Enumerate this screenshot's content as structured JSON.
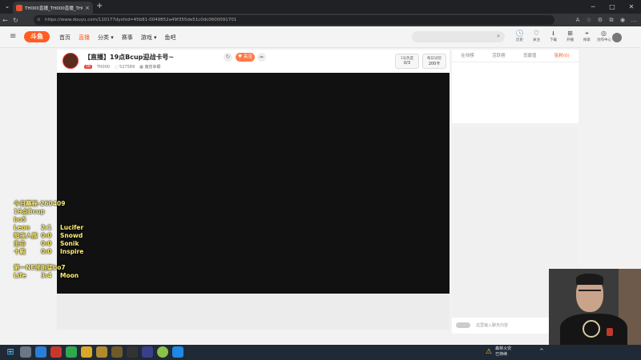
{
  "browser": {
    "tab_title": "TH000直播_TH000直播_TH000视频",
    "tab_close": "×",
    "new_tab": "+",
    "url": "https://www.douyu.com/110177dyshid=45b81-0049852a49f355de51c0dc0600091701",
    "window_controls": [
      "─",
      "□",
      "✕"
    ]
  },
  "site": {
    "logo_text": "斗鱼",
    "nav": [
      {
        "label": "首页",
        "active": false
      },
      {
        "label": "直播",
        "active": true
      },
      {
        "label": "分类 ▾",
        "active": false
      },
      {
        "label": "赛事",
        "active": false
      },
      {
        "label": "游戏 ▾",
        "active": false
      },
      {
        "label": "鱼吧",
        "active": false
      }
    ],
    "header_icons": [
      {
        "icon": "history-icon",
        "glyph": "🕒",
        "label": "历史"
      },
      {
        "icon": "heart-icon",
        "glyph": "♡",
        "label": "关注"
      },
      {
        "icon": "download-icon",
        "glyph": "⭳",
        "label": "下载"
      },
      {
        "icon": "broadcast-icon",
        "glyph": "⊞",
        "label": "开播"
      },
      {
        "icon": "map-pin-icon",
        "glyph": "⌖",
        "label": "探索"
      },
      {
        "icon": "creator-icon",
        "glyph": "◎",
        "label": "创作中心"
      }
    ]
  },
  "room": {
    "title": "【直播】19点Bcup迎战卡号~",
    "follow_label": "关注",
    "level_badge": "18",
    "streamer": "TH000",
    "hot_count": "527589",
    "category": "魔兽争霸",
    "hot_label": "1号热度",
    "hot_value": "0/3",
    "daily_label": "每日试玩",
    "daily_value": "200卡"
  },
  "overlay": {
    "line1": "今日赛程-260409",
    "line2": "19点Bcup",
    "line3": "bo5",
    "matches": [
      {
        "a": "Leon",
        "score": "2:1",
        "b": "Lucifer"
      },
      {
        "a": "暗夜人族",
        "score": "0:0",
        "b": "Snowd"
      },
      {
        "a": "生命",
        "score": "0:0",
        "b": "Sonik"
      },
      {
        "a": "十殿",
        "score": "0:0",
        "b": "Inspire"
      }
    ],
    "line_final": "第一NE领跑猛bo7",
    "final_match": {
      "a": "Life",
      "score": "3:4",
      "b": "Moon"
    }
  },
  "right_panel": {
    "tabs": [
      {
        "label": "在线榜",
        "active": false
      },
      {
        "label": "活跃榜",
        "active": false
      },
      {
        "label": "贡献值",
        "active": false
      },
      {
        "label": "贴粉(0)",
        "active": true
      }
    ],
    "chat_placeholder": "这里输入聊天内容"
  },
  "taskbar": {
    "weather_title": "森林火灾",
    "weather_sub": "已持续",
    "tray_chevron": "^"
  }
}
